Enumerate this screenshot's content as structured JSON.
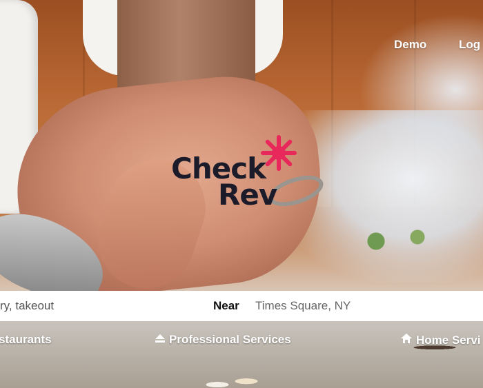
{
  "nav": {
    "demo_label": "Demo",
    "login_label": "Log"
  },
  "logo": {
    "line1": "Check",
    "line2": "Rev",
    "star_color": "#e8285a"
  },
  "search": {
    "what_value": "ry, takeout",
    "near_label": "Near",
    "near_value": "Times Square, NY"
  },
  "categories": [
    {
      "label": "staurants",
      "icon": "restaurant-icon"
    },
    {
      "label": "Professional Services",
      "icon": "eject-icon"
    },
    {
      "label": "Home Servi",
      "icon": "home-icon"
    }
  ]
}
